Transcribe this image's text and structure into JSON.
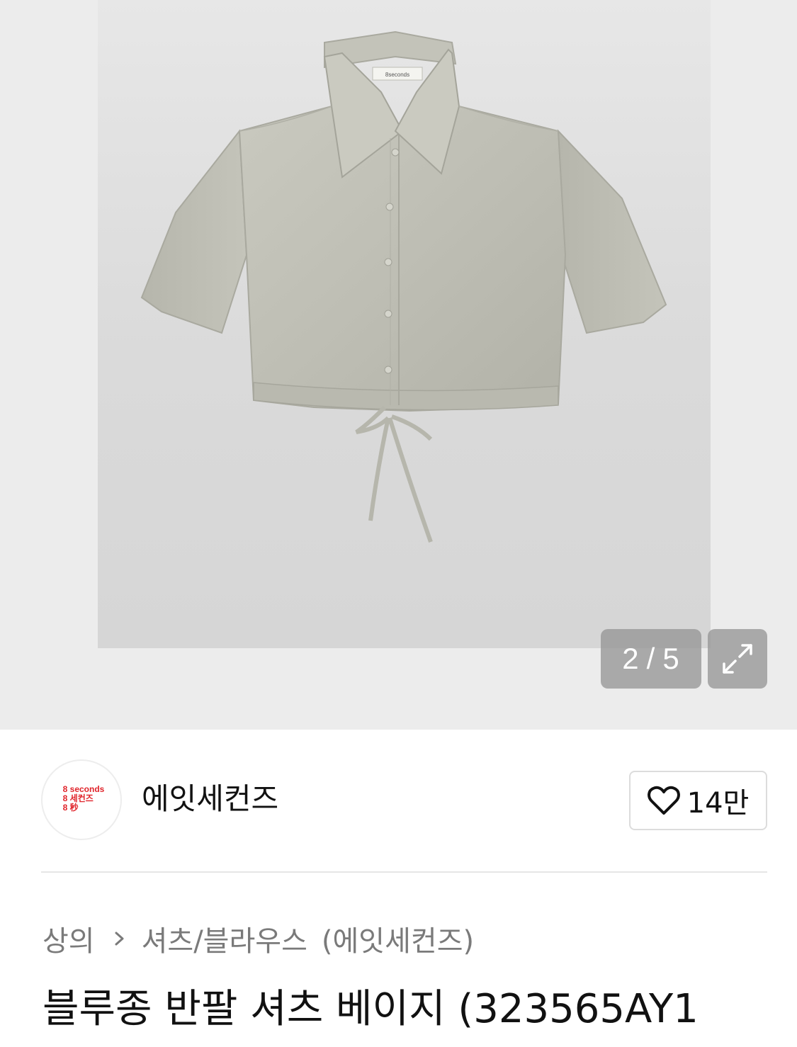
{
  "gallery": {
    "current": "2",
    "separator": "/",
    "total": "5",
    "expand_icon": "expand-arrows-icon",
    "photo_label": "8seconds"
  },
  "brand": {
    "logo_lines": [
      "8 seconds",
      "8 세컨즈",
      "8 秒"
    ],
    "logo_color": "#e0242b",
    "name": "에잇세컨즈",
    "like_icon": "heart-outline-icon",
    "like_count": "14만"
  },
  "category": {
    "level1": "상의",
    "level2": "셔츠/블라우스",
    "brand": "(에잇세컨즈)",
    "separator_icon": "chevron-right-icon"
  },
  "product": {
    "title": "블루종 반팔 셔츠 베이지 (323565AY1"
  }
}
